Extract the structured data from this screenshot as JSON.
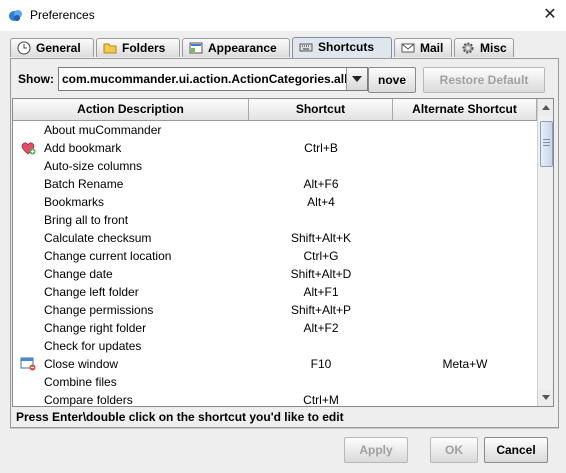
{
  "window": {
    "title": "Preferences",
    "close_glyph": "✕"
  },
  "tabs": [
    {
      "label": "General",
      "icon": "clock-icon",
      "active": false
    },
    {
      "label": "Folders",
      "icon": "folder-icon",
      "active": false
    },
    {
      "label": "Appearance",
      "icon": "appearance-icon",
      "active": false
    },
    {
      "label": "Shortcuts",
      "icon": "keyboard-icon",
      "active": true
    },
    {
      "label": "Mail",
      "icon": "mail-icon",
      "active": false
    },
    {
      "label": "Misc",
      "icon": "gear-icon",
      "active": false
    }
  ],
  "toolbar": {
    "show_label": "Show:",
    "category_value": "com.mucommander.ui.action.ActionCategories.all",
    "remove_label": "nove",
    "restore_default_label": "Restore Default"
  },
  "table": {
    "columns": [
      "Action Description",
      "Shortcut",
      "Alternate Shortcut"
    ],
    "rows": [
      {
        "desc": "About muCommander",
        "shortcut": "",
        "alt": "",
        "icon": ""
      },
      {
        "desc": "Add bookmark",
        "shortcut": "Ctrl+B",
        "alt": "",
        "icon": "bookmark-add-icon"
      },
      {
        "desc": "Auto-size columns",
        "shortcut": "",
        "alt": "",
        "icon": ""
      },
      {
        "desc": "Batch Rename",
        "shortcut": "Alt+F6",
        "alt": "",
        "icon": ""
      },
      {
        "desc": "Bookmarks",
        "shortcut": "Alt+4",
        "alt": "",
        "icon": ""
      },
      {
        "desc": "Bring all to front",
        "shortcut": "",
        "alt": "",
        "icon": ""
      },
      {
        "desc": "Calculate checksum",
        "shortcut": "Shift+Alt+K",
        "alt": "",
        "icon": ""
      },
      {
        "desc": "Change current location",
        "shortcut": "Ctrl+G",
        "alt": "",
        "icon": ""
      },
      {
        "desc": "Change date",
        "shortcut": "Shift+Alt+D",
        "alt": "",
        "icon": ""
      },
      {
        "desc": "Change left folder",
        "shortcut": "Alt+F1",
        "alt": "",
        "icon": ""
      },
      {
        "desc": "Change permissions",
        "shortcut": "Shift+Alt+P",
        "alt": "",
        "icon": ""
      },
      {
        "desc": "Change right folder",
        "shortcut": "Alt+F2",
        "alt": "",
        "icon": ""
      },
      {
        "desc": "Check for updates",
        "shortcut": "",
        "alt": "",
        "icon": ""
      },
      {
        "desc": "Close window",
        "shortcut": "F10",
        "alt": "Meta+W",
        "icon": "close-window-icon"
      },
      {
        "desc": "Combine files",
        "shortcut": "",
        "alt": "",
        "icon": ""
      },
      {
        "desc": "Compare folders",
        "shortcut": "Ctrl+M",
        "alt": "",
        "icon": ""
      }
    ]
  },
  "status_text": "Press Enter\\double click on the shortcut you'd like to edit",
  "footer": {
    "apply_label": "Apply",
    "ok_label": "OK",
    "cancel_label": "Cancel"
  }
}
